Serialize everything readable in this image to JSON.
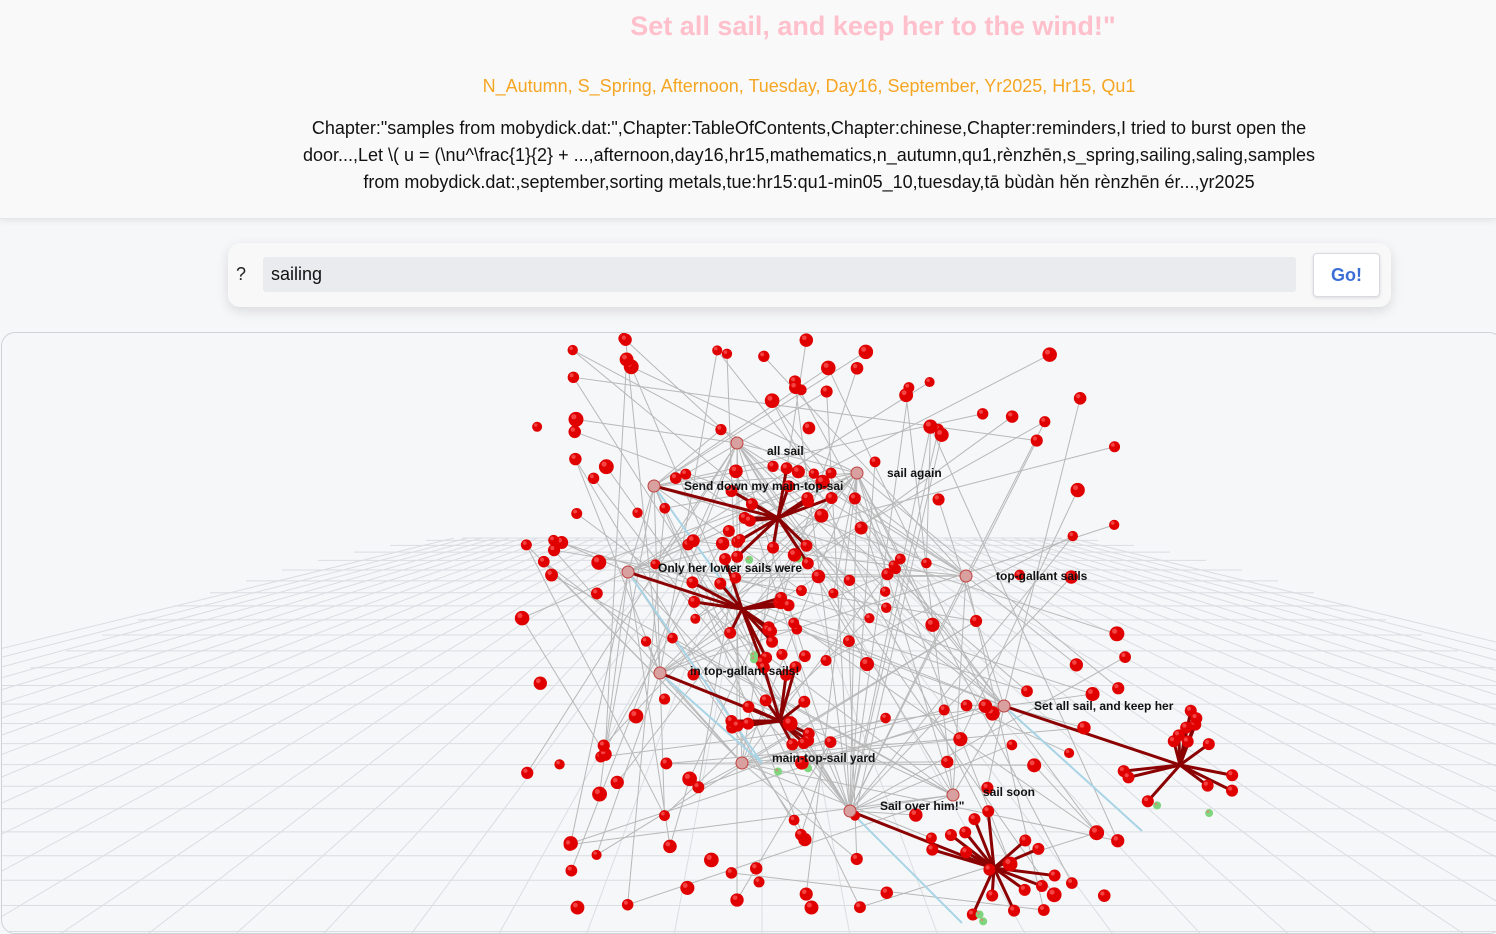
{
  "header": {
    "title": "Set all sail, and keep her to the wind!\"",
    "tags_line": "N_Autumn, S_Spring, Afternoon, Tuesday, Day16, September, Yr2025, Hr15, Qu1",
    "chapter_line": "Chapter:\"samples from mobydick.dat:\",Chapter:TableOfContents,Chapter:chinese,Chapter:reminders,I tried to burst open the door...,Let \\( u = (\\nu^\\frac{1}{2} + ...,afternoon,day16,hr15,mathematics,n_autumn,qu1,rènzhēn,s_spring,sailing,saling,samples from mobydick.dat:,september,sorting metals,tue:hr15:qu1-min05_10,tuesday,tā bùdàn hěn rènzhēn ér...,yr2025"
  },
  "search": {
    "prompt": "?",
    "value": "sailing",
    "go_label": "Go!"
  },
  "graph": {
    "colors": {
      "node": "#e00000",
      "hub_edge": "#8b0000",
      "edge": "#b8b8b8",
      "aux_edge": "#a8d4e6",
      "aux_node": "#7ed67e",
      "grid": "#dadde1"
    },
    "labels": [
      "all sail",
      "sail again",
      "Send down my main-top-sai",
      "Only her lower sails were",
      "top-gallant sails",
      "in top-gallant sails!",
      "Set all sail, and keep her",
      "main-top-sail yard",
      "sail soon",
      "Sail over him!\""
    ]
  }
}
